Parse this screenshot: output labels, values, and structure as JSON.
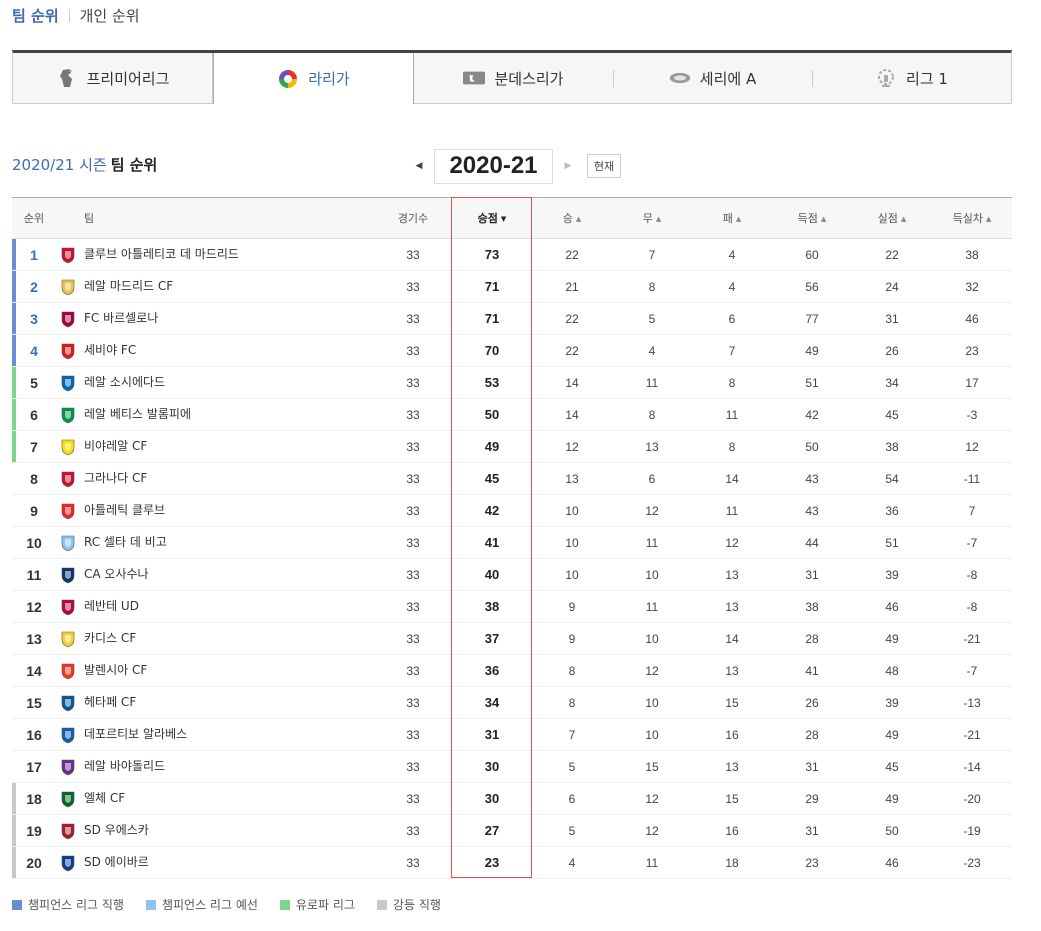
{
  "top_tabs": {
    "active": "팀 순위",
    "other": "개인 순위"
  },
  "leagues": [
    {
      "label": "프리미어리그",
      "icon": "premier-league-logo-icon",
      "active": false
    },
    {
      "label": "라리가",
      "icon": "laliga-logo-icon",
      "active": true
    },
    {
      "label": "분데스리가",
      "icon": "bundesliga-logo-icon",
      "active": false
    },
    {
      "label": "세리에 A",
      "icon": "serie-a-logo-icon",
      "active": false
    },
    {
      "label": "리그 1",
      "icon": "ligue-1-logo-icon",
      "active": false
    }
  ],
  "season": {
    "title_blue": "2020/21 시즌",
    "title_dark": "팀 순위",
    "selected": "2020-21",
    "now_label": "현재"
  },
  "table": {
    "headers": {
      "rank": "순위",
      "team": "팀",
      "played": "경기수",
      "points": "승점",
      "wins": "승",
      "draws": "무",
      "losses": "패",
      "goals_for": "득점",
      "goals_against": "실점",
      "goal_diff": "득실차"
    },
    "sorted_by": "points",
    "rows": [
      {
        "rank": "1",
        "team": "클루브 아틀레티코 데 마드리드",
        "played": "33",
        "points": "73",
        "w": "22",
        "d": "7",
        "l": "4",
        "gf": "60",
        "ga": "22",
        "gd": "38",
        "zone": "cl_direct",
        "crest": "atletico-madrid-crest-icon"
      },
      {
        "rank": "2",
        "team": "레알 마드리드 CF",
        "played": "33",
        "points": "71",
        "w": "21",
        "d": "8",
        "l": "4",
        "gf": "56",
        "ga": "24",
        "gd": "32",
        "zone": "cl_direct",
        "crest": "real-madrid-crest-icon"
      },
      {
        "rank": "3",
        "team": "FC 바르셀로나",
        "played": "33",
        "points": "71",
        "w": "22",
        "d": "5",
        "l": "6",
        "gf": "77",
        "ga": "31",
        "gd": "46",
        "zone": "cl_direct",
        "crest": "barcelona-crest-icon"
      },
      {
        "rank": "4",
        "team": "세비야 FC",
        "played": "33",
        "points": "70",
        "w": "22",
        "d": "4",
        "l": "7",
        "gf": "49",
        "ga": "26",
        "gd": "23",
        "zone": "cl_direct",
        "crest": "sevilla-crest-icon"
      },
      {
        "rank": "5",
        "team": "레알 소시에다드",
        "played": "33",
        "points": "53",
        "w": "14",
        "d": "11",
        "l": "8",
        "gf": "51",
        "ga": "34",
        "gd": "17",
        "zone": "europa",
        "crest": "real-sociedad-crest-icon"
      },
      {
        "rank": "6",
        "team": "레알 베티스 발롬피에",
        "played": "33",
        "points": "50",
        "w": "14",
        "d": "8",
        "l": "11",
        "gf": "42",
        "ga": "45",
        "gd": "-3",
        "zone": "europa",
        "crest": "real-betis-crest-icon"
      },
      {
        "rank": "7",
        "team": "비야레알 CF",
        "played": "33",
        "points": "49",
        "w": "12",
        "d": "13",
        "l": "8",
        "gf": "50",
        "ga": "38",
        "gd": "12",
        "zone": "europa",
        "crest": "villarreal-crest-icon"
      },
      {
        "rank": "8",
        "team": "그라나다 CF",
        "played": "33",
        "points": "45",
        "w": "13",
        "d": "6",
        "l": "14",
        "gf": "43",
        "ga": "54",
        "gd": "-11",
        "zone": "none",
        "crest": "granada-crest-icon"
      },
      {
        "rank": "9",
        "team": "아틀레틱 클루브",
        "played": "33",
        "points": "42",
        "w": "10",
        "d": "12",
        "l": "11",
        "gf": "43",
        "ga": "36",
        "gd": "7",
        "zone": "none",
        "crest": "athletic-club-crest-icon"
      },
      {
        "rank": "10",
        "team": "RC 셀타 데 비고",
        "played": "33",
        "points": "41",
        "w": "10",
        "d": "11",
        "l": "12",
        "gf": "44",
        "ga": "51",
        "gd": "-7",
        "zone": "none",
        "crest": "celta-vigo-crest-icon"
      },
      {
        "rank": "11",
        "team": "CA 오사수나",
        "played": "33",
        "points": "40",
        "w": "10",
        "d": "10",
        "l": "13",
        "gf": "31",
        "ga": "39",
        "gd": "-8",
        "zone": "none",
        "crest": "osasuna-crest-icon"
      },
      {
        "rank": "12",
        "team": "레반테 UD",
        "played": "33",
        "points": "38",
        "w": "9",
        "d": "11",
        "l": "13",
        "gf": "38",
        "ga": "46",
        "gd": "-8",
        "zone": "none",
        "crest": "levante-crest-icon"
      },
      {
        "rank": "13",
        "team": "카디스 CF",
        "played": "33",
        "points": "37",
        "w": "9",
        "d": "10",
        "l": "14",
        "gf": "28",
        "ga": "49",
        "gd": "-21",
        "zone": "none",
        "crest": "cadiz-crest-icon"
      },
      {
        "rank": "14",
        "team": "발렌시아 CF",
        "played": "33",
        "points": "36",
        "w": "8",
        "d": "12",
        "l": "13",
        "gf": "41",
        "ga": "48",
        "gd": "-7",
        "zone": "none",
        "crest": "valencia-crest-icon"
      },
      {
        "rank": "15",
        "team": "헤타페 CF",
        "played": "33",
        "points": "34",
        "w": "8",
        "d": "10",
        "l": "15",
        "gf": "26",
        "ga": "39",
        "gd": "-13",
        "zone": "none",
        "crest": "getafe-crest-icon"
      },
      {
        "rank": "16",
        "team": "데포르티보 알라베스",
        "played": "33",
        "points": "31",
        "w": "7",
        "d": "10",
        "l": "16",
        "gf": "28",
        "ga": "49",
        "gd": "-21",
        "zone": "none",
        "crest": "alaves-crest-icon"
      },
      {
        "rank": "17",
        "team": "레알 바야돌리드",
        "played": "33",
        "points": "30",
        "w": "5",
        "d": "15",
        "l": "13",
        "gf": "31",
        "ga": "45",
        "gd": "-14",
        "zone": "none",
        "crest": "valladolid-crest-icon"
      },
      {
        "rank": "18",
        "team": "엘체 CF",
        "played": "33",
        "points": "30",
        "w": "6",
        "d": "12",
        "l": "15",
        "gf": "29",
        "ga": "49",
        "gd": "-20",
        "zone": "relegation",
        "crest": "elche-crest-icon"
      },
      {
        "rank": "19",
        "team": "SD 우에스카",
        "played": "33",
        "points": "27",
        "w": "5",
        "d": "12",
        "l": "16",
        "gf": "31",
        "ga": "50",
        "gd": "-19",
        "zone": "relegation",
        "crest": "huesca-crest-icon"
      },
      {
        "rank": "20",
        "team": "SD 에이바르",
        "played": "33",
        "points": "23",
        "w": "4",
        "d": "11",
        "l": "18",
        "gf": "23",
        "ga": "46",
        "gd": "-23",
        "zone": "relegation",
        "crest": "eibar-crest-icon"
      }
    ]
  },
  "legend": [
    {
      "label": "챔피언스 리그 직행",
      "zone": "cl_direct"
    },
    {
      "label": "챔피언스 리그 예선",
      "zone": "cl_qual"
    },
    {
      "label": "유로파 리그",
      "zone": "europa"
    },
    {
      "label": "강등 직행",
      "zone": "relegation"
    }
  ],
  "colors": {
    "accent": "#3d6bb3",
    "cl_direct": "#6a8fd0",
    "cl_qual": "#8fc3ea",
    "europa": "#7fd68a",
    "relegation": "#c8c8c8",
    "sort_highlight": "#d9534f"
  }
}
